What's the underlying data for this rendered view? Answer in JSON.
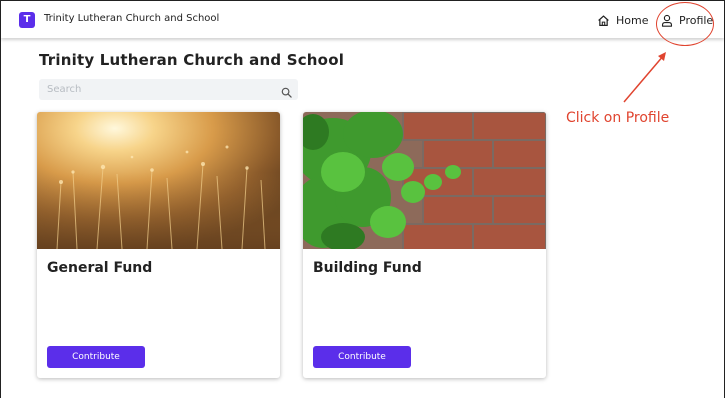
{
  "header": {
    "logo_letter": "T",
    "org_name": "Trinity Lutheran Church and School",
    "nav": {
      "home_label": "Home",
      "profile_label": "Profile"
    }
  },
  "main": {
    "title": "Trinity Lutheran Church and School",
    "search": {
      "placeholder": "Search",
      "value": ""
    },
    "funds": [
      {
        "title": "General Fund",
        "button_label": "Contribute",
        "image_icon": "golden-field-photo"
      },
      {
        "title": "Building Fund",
        "button_label": "Contribute",
        "image_icon": "ivy-brick-wall-photo"
      }
    ]
  },
  "annotation": {
    "text": "Click on Profile",
    "color": "#e0442f"
  },
  "colors": {
    "brand": "#5b2eea",
    "search_bg": "#f1f3f5"
  }
}
